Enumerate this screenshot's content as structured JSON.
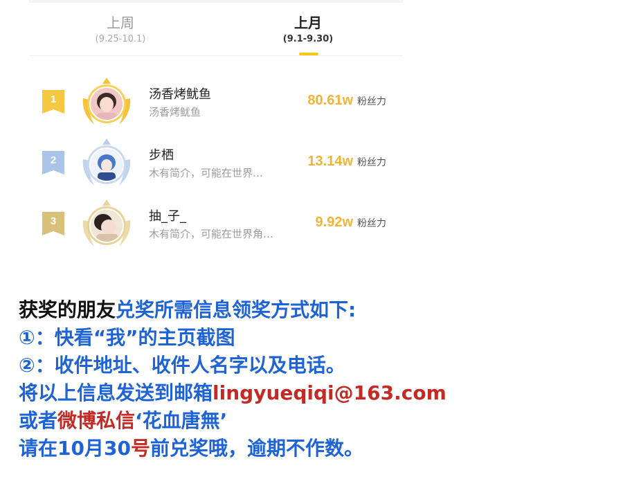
{
  "tabs": [
    {
      "label": "上周",
      "range": "(9.25-10.1)"
    },
    {
      "label": "上月",
      "range": "(9.1-9.30)"
    }
  ],
  "ranking": [
    {
      "rank": "1",
      "name": "汤香烤鱿鱼",
      "bio": "汤香烤鱿鱼",
      "score": "80.61w",
      "unit": "粉丝力"
    },
    {
      "rank": "2",
      "name": "步栖",
      "bio": "木有简介，可能在世界…",
      "score": "13.14w",
      "unit": "粉丝力"
    },
    {
      "rank": "3",
      "name": "抽_子_",
      "bio": "木有简介，可能在世界角…",
      "score": "9.92w",
      "unit": "粉丝力"
    }
  ],
  "notice": {
    "l1_black": "获奖的朋友",
    "l1_blue": "兑奖所需信息领奖方式如下:",
    "l2": "①：快看“我”的主页截图",
    "l3": "②：收件地址、收件人名字以及电话。",
    "l4_blue": "将以上信息发送到邮箱",
    "l4_red": "lingyueqiqi@163.com",
    "l5_blue": "或者",
    "l5_red": "微博私信",
    "l5_blue2": "‘花血唐無’",
    "l6_blue": "请在10月30",
    "l6_red": "号",
    "l6_blue2": "前兑奖哦，逾期不作数。"
  },
  "colors": {
    "gold": "#f1b434",
    "blue": "#1d63d6",
    "red": "#c42a24",
    "tab_indicator": "#f7c719"
  }
}
